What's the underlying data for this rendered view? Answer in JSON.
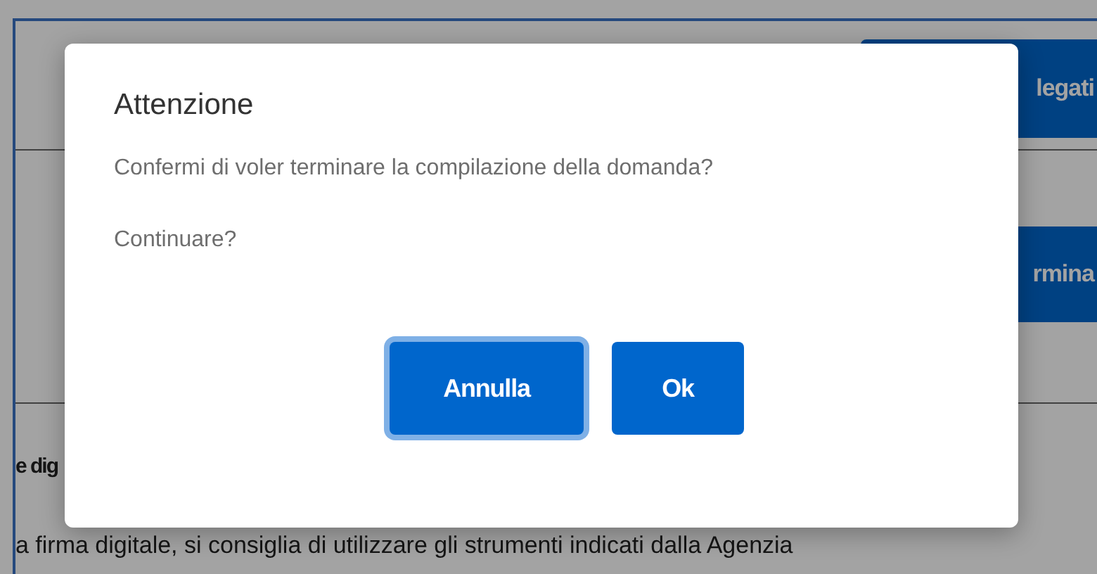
{
  "page": {
    "top_button": "legati",
    "action_button": "rmina",
    "section_heading": "e dig",
    "section_text": "a firma digitale, si consiglia di utilizzare gli strumenti indicati dalla Agenzia"
  },
  "dialog": {
    "title": "Attenzione",
    "messages": [
      "Confermi di voler terminare la compilazione della domanda?",
      "Continuare?"
    ],
    "buttons": [
      {
        "label": "Annulla",
        "focused": true
      },
      {
        "label": "Ok",
        "focused": false
      }
    ]
  }
}
